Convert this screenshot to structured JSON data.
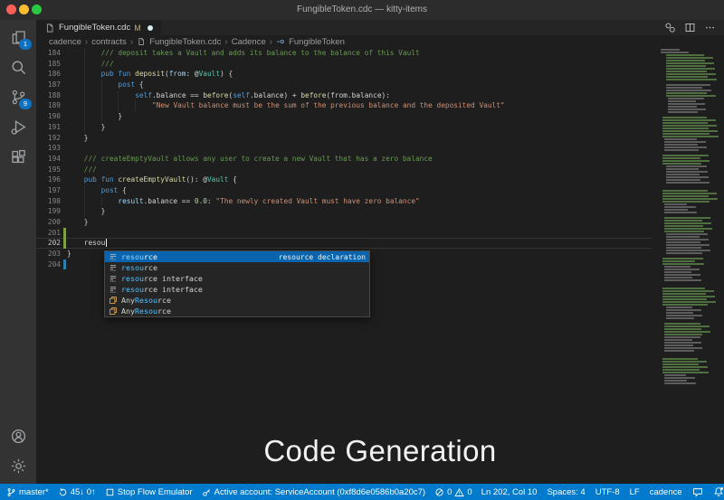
{
  "window": {
    "title": "FungibleToken.cdc — kitty-items"
  },
  "activity_bar": {
    "explorer_badge": "1",
    "scm_badge": "9"
  },
  "tab": {
    "label": "FungibleToken.cdc",
    "git_status": "M"
  },
  "breadcrumb": {
    "items": [
      "cadence",
      "contracts",
      "FungibleToken.cdc",
      "Cadence",
      "FungibleToken"
    ]
  },
  "editor": {
    "caption": "Code Generation",
    "lines": [
      {
        "n": 184,
        "i": 8,
        "t": [
          [
            "c",
            "/// deposit takes a Vault and adds its balance to the balance of this Vault"
          ]
        ]
      },
      {
        "n": 185,
        "i": 8,
        "t": [
          [
            "c",
            "///"
          ]
        ]
      },
      {
        "n": 186,
        "i": 8,
        "t": [
          [
            "k",
            "pub fun "
          ],
          [
            "f",
            "deposit"
          ],
          [
            "p",
            "("
          ],
          [
            "v",
            "from"
          ],
          [
            "p",
            ": @"
          ],
          [
            "t",
            "Vault"
          ],
          [
            "p",
            ") {"
          ]
        ]
      },
      {
        "n": 187,
        "i": 12,
        "t": [
          [
            "k",
            "post"
          ],
          [
            "p",
            " {"
          ]
        ]
      },
      {
        "n": 188,
        "i": 16,
        "t": [
          [
            "k",
            "self"
          ],
          [
            "p",
            ".balance == "
          ],
          [
            "f",
            "before"
          ],
          [
            "p",
            "("
          ],
          [
            "k",
            "self"
          ],
          [
            "p",
            ".balance) + "
          ],
          [
            "f",
            "before"
          ],
          [
            "p",
            "(from.balance):"
          ]
        ]
      },
      {
        "n": 189,
        "i": 20,
        "t": [
          [
            "s",
            "\"New Vault balance must be the sum of the previous balance and the deposited Vault\""
          ]
        ]
      },
      {
        "n": 190,
        "i": 12,
        "t": [
          [
            "p",
            "}"
          ]
        ]
      },
      {
        "n": 191,
        "i": 8,
        "t": [
          [
            "p",
            "}"
          ]
        ]
      },
      {
        "n": 192,
        "i": 4,
        "t": [
          [
            "p",
            "}"
          ]
        ]
      },
      {
        "n": 193,
        "i": 0,
        "t": []
      },
      {
        "n": 194,
        "i": 4,
        "t": [
          [
            "c",
            "/// createEmptyVault allows any user to create a new Vault that has a zero balance"
          ]
        ]
      },
      {
        "n": 195,
        "i": 4,
        "t": [
          [
            "c",
            "///"
          ]
        ]
      },
      {
        "n": 196,
        "i": 4,
        "t": [
          [
            "k",
            "pub fun "
          ],
          [
            "f",
            "createEmptyVault"
          ],
          [
            "p",
            "(): @"
          ],
          [
            "t",
            "Vault"
          ],
          [
            "p",
            " {"
          ]
        ]
      },
      {
        "n": 197,
        "i": 8,
        "t": [
          [
            "k",
            "post"
          ],
          [
            "p",
            " {"
          ]
        ]
      },
      {
        "n": 198,
        "i": 12,
        "t": [
          [
            "v",
            "result"
          ],
          [
            "p",
            ".balance == "
          ],
          [
            "n",
            "0.0"
          ],
          [
            "p",
            ": "
          ],
          [
            "s",
            "\"The newly created Vault must have zero balance\""
          ]
        ]
      },
      {
        "n": 199,
        "i": 8,
        "t": [
          [
            "p",
            "}"
          ]
        ]
      },
      {
        "n": 200,
        "i": 4,
        "t": [
          [
            "p",
            "}"
          ]
        ]
      },
      {
        "n": 201,
        "i": 0,
        "t": [],
        "git": "a"
      },
      {
        "n": 202,
        "i": 4,
        "t": [
          [
            "p",
            "resou"
          ]
        ],
        "git": "a",
        "cur": true,
        "cursor": true
      },
      {
        "n": 203,
        "i": 0,
        "t": [
          [
            "p",
            "}"
          ]
        ]
      },
      {
        "n": 204,
        "i": 0,
        "t": [],
        "git": "m"
      }
    ]
  },
  "suggest": {
    "items": [
      {
        "kind": "snippet",
        "pre": "",
        "match": "resou",
        "rest": "rce",
        "detail": "resource declaration",
        "selected": true
      },
      {
        "kind": "snippet",
        "pre": "",
        "match": "resou",
        "rest": "rce"
      },
      {
        "kind": "snippet",
        "pre": "",
        "match": "resou",
        "rest": "rce interface"
      },
      {
        "kind": "snippet",
        "pre": "",
        "match": "resou",
        "rest": "rce interface"
      },
      {
        "kind": "class",
        "pre": "Any",
        "match": "Resou",
        "rest": "rce"
      },
      {
        "kind": "class",
        "pre": "Any",
        "match": "Resou",
        "rest": "rce"
      }
    ]
  },
  "status_bar": {
    "branch": "master*",
    "sync": "45↓ 0↑",
    "stop": "Stop Flow Emulator",
    "account": "Active account: ServiceAccount (0xf8d6e0586b0a20c7)",
    "errors": "0",
    "warnings": "0",
    "cursor_position": "Ln 202, Col 10",
    "indentation": "Spaces: 4",
    "encoding": "UTF-8",
    "eol": "LF",
    "language": "cadence"
  },
  "colors": {
    "accent": "#007acc",
    "suggest_selection": "#0a64ad",
    "match_highlight": "#4fc1ff",
    "git_added": "#7fa042",
    "git_modified": "#2a7fae",
    "badge": "#0e70c0"
  },
  "minimap": {
    "sections": [
      [
        2,
        "w",
        4,
        30
      ],
      [
        10,
        "g",
        10,
        50
      ],
      [
        1,
        "x",
        0,
        0
      ],
      [
        3,
        "w",
        10,
        42
      ],
      [
        2,
        "g",
        10,
        46
      ],
      [
        6,
        "w",
        12,
        40
      ],
      [
        1,
        "x",
        0,
        0
      ],
      [
        8,
        "g",
        6,
        55
      ],
      [
        5,
        "w",
        8,
        38
      ],
      [
        1,
        "x",
        0,
        0
      ],
      [
        4,
        "g",
        6,
        50
      ],
      [
        7,
        "w",
        10,
        42
      ],
      [
        2,
        "x",
        0,
        0
      ],
      [
        5,
        "g",
        6,
        52
      ],
      [
        4,
        "w",
        8,
        34
      ],
      [
        1,
        "x",
        0,
        0
      ],
      [
        6,
        "g",
        8,
        48
      ],
      [
        8,
        "w",
        10,
        40
      ],
      [
        1,
        "x",
        0,
        0
      ],
      [
        3,
        "g",
        6,
        44
      ],
      [
        6,
        "w",
        8,
        36
      ],
      [
        2,
        "x",
        0,
        0
      ],
      [
        7,
        "g",
        6,
        50
      ],
      [
        5,
        "w",
        10,
        38
      ],
      [
        1,
        "x",
        0,
        0
      ],
      [
        5,
        "g",
        8,
        46
      ],
      [
        6,
        "w",
        8,
        34
      ],
      [
        2,
        "x",
        0,
        0
      ],
      [
        6,
        "g",
        6,
        48
      ],
      [
        4,
        "w",
        8,
        30
      ]
    ]
  }
}
